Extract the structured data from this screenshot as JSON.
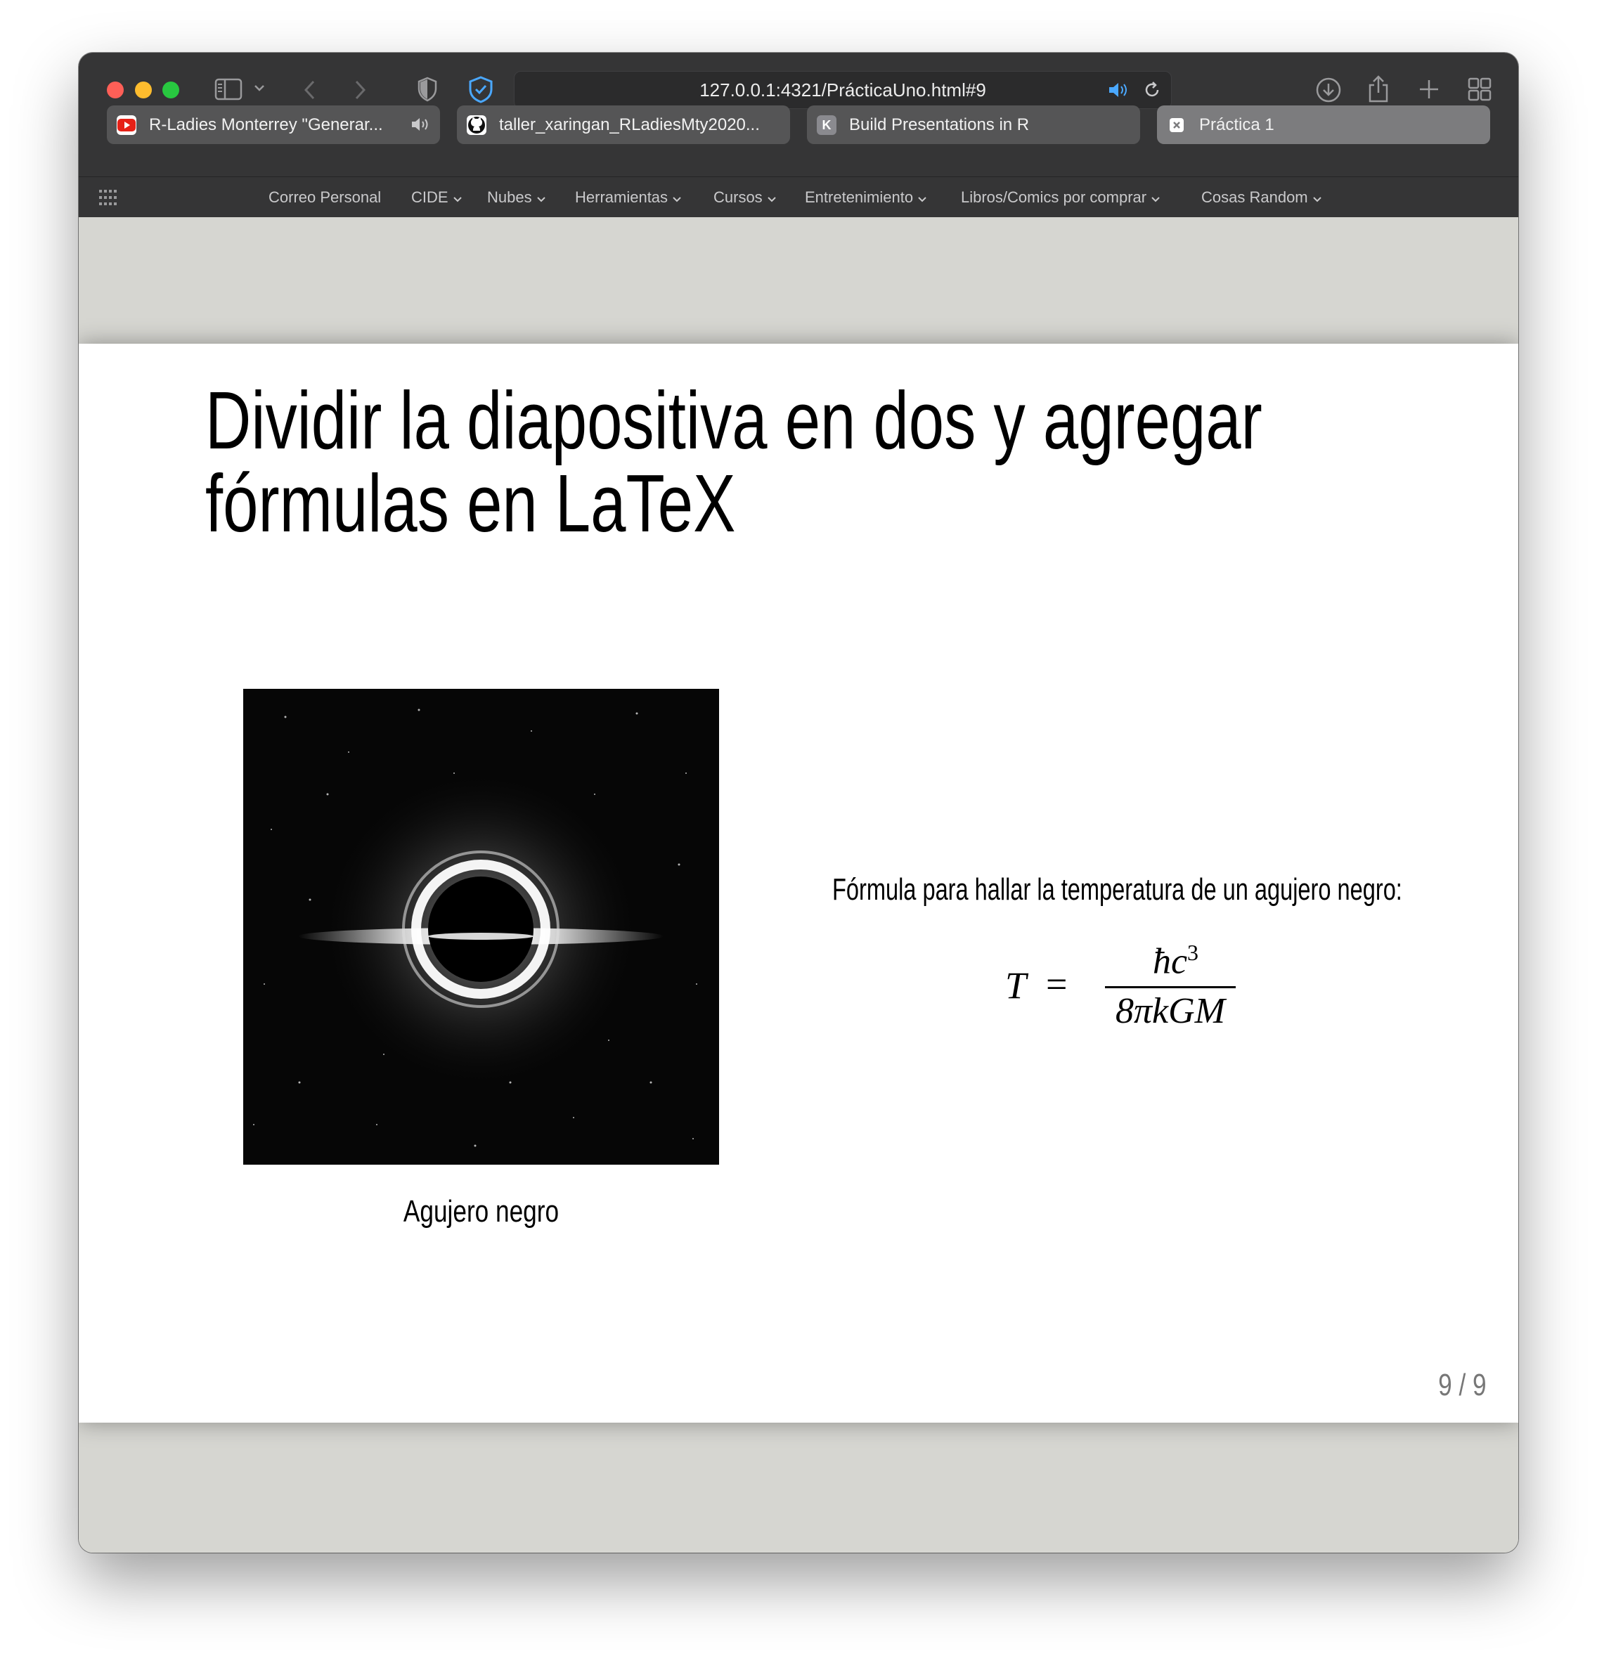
{
  "browser": {
    "url": "127.0.0.1:4321/PrácticaUno.html#9",
    "tabs": [
      {
        "label": "R-Ladies Monterrey \"Generar...",
        "favicon": "youtube-icon",
        "favicon_color": "#e62117",
        "audio": true
      },
      {
        "label": "taller_xaringan_RLadiesMty2020...",
        "favicon": "github-icon",
        "favicon_color": "#ffffff",
        "audio": false
      },
      {
        "label": "Build Presentations in R",
        "favicon": "k-icon",
        "favicon_glyph": "K",
        "favicon_color": "#8a8a8f",
        "audio": false
      },
      {
        "label": "Práctica 1",
        "favicon": "close-icon",
        "favicon_color": "#ffffff",
        "audio": false,
        "active": true
      }
    ],
    "bookmarks": [
      {
        "label": "Correo Personal",
        "dropdown": false
      },
      {
        "label": "CIDE",
        "dropdown": true
      },
      {
        "label": "Nubes",
        "dropdown": true
      },
      {
        "label": "Herramientas",
        "dropdown": true
      },
      {
        "label": "Cursos",
        "dropdown": true
      },
      {
        "label": "Entretenimiento",
        "dropdown": true
      },
      {
        "label": "Libros/Comics por comprar",
        "dropdown": true
      },
      {
        "label": "Cosas Random",
        "dropdown": true
      }
    ],
    "accent_color": "#4aa8ff"
  },
  "slide": {
    "title": "Dividir la diapositiva en dos y agregar fórmulas en LaTeX",
    "image_caption": "Agujero negro",
    "formula_label": "Fórmula para hallar la temperatura de un agujero negro:",
    "formula": {
      "lhs": "T",
      "equals": "=",
      "numerator": "ħc",
      "numerator_exponent": "3",
      "denominator": "8πkGM"
    },
    "page_number": "9 / 9"
  }
}
